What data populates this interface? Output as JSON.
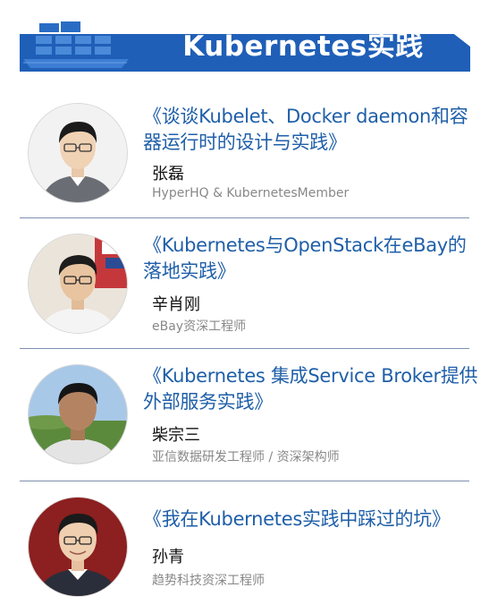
{
  "header": {
    "title": "Kubernetes实践"
  },
  "speakers": [
    {
      "talk": "《谈谈Kubelet、Docker daemon和容器运行时的设计与实践》",
      "name": "张磊",
      "role": "HyperHQ & KubernetesMember"
    },
    {
      "talk": "《Kubernetes与OpenStack在eBay的落地实践》",
      "name": "辛肖刚",
      "role": "eBay资深工程师"
    },
    {
      "talk": "《Kubernetes 集成Service Broker提供外部服务实践》",
      "name": "柴宗三",
      "role": "亚信数据研发工程师 / 资深架构师"
    },
    {
      "talk": "《我在Kubernetes实践中踩过的坑》",
      "name": "孙青",
      "role": "趋势科技资深工程师"
    }
  ],
  "colors": {
    "banner": "#1f5fb8",
    "talk_title": "#1f5fa8",
    "divider": "#7f8fb0"
  }
}
